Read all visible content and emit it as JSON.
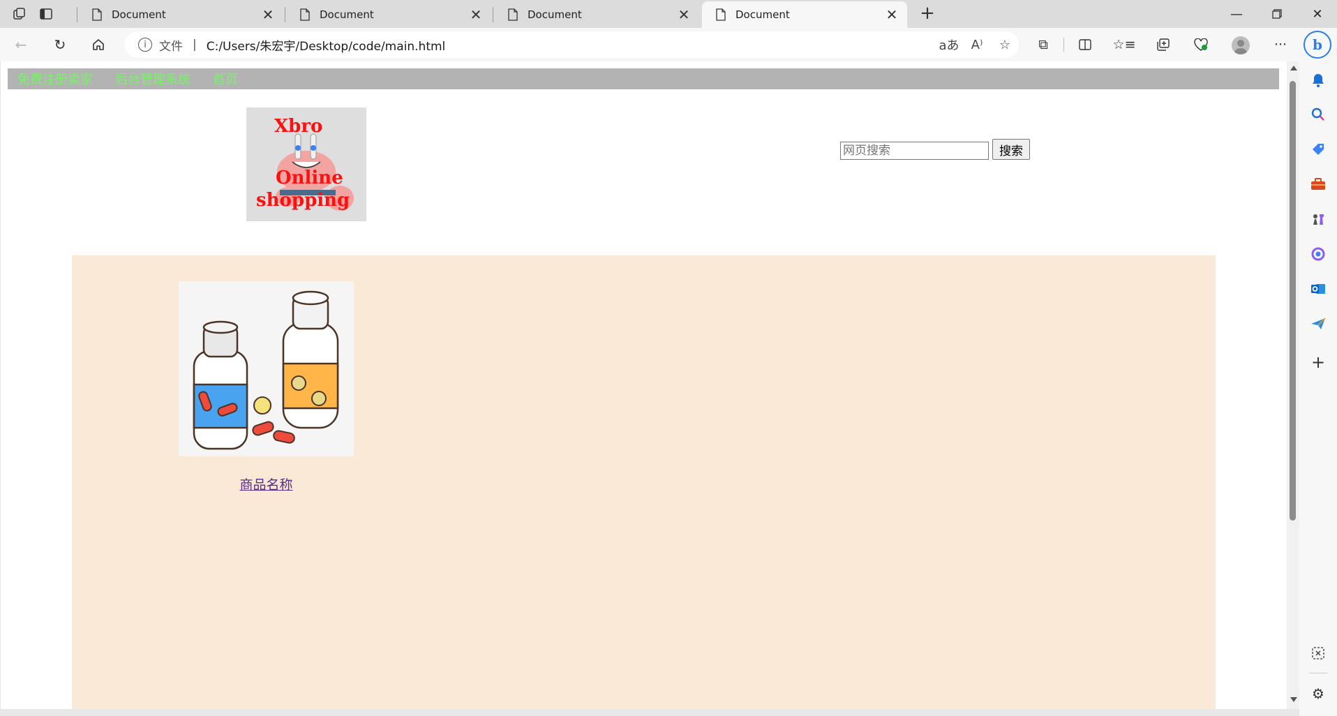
{
  "browser": {
    "tabs": [
      {
        "title": "Document",
        "active": false
      },
      {
        "title": "Document",
        "active": false
      },
      {
        "title": "Document",
        "active": false
      },
      {
        "title": "Document",
        "active": true
      }
    ],
    "address": {
      "label": "文件",
      "url": "C:/Users/朱宏宇/Desktop/code/main.html"
    }
  },
  "page": {
    "nav": {
      "links": [
        "免费注册卖家",
        "后台管理系统",
        "首页"
      ],
      "link_color": "#7cf06c",
      "bar_color": "#b3b3b3"
    },
    "logo": {
      "line1": "Xbro",
      "line2": "Online",
      "line3": "shopping"
    },
    "search": {
      "placeholder": "网页搜索",
      "button_label": "搜索"
    },
    "products": {
      "background": "#f9e9d6",
      "items": [
        {
          "name": "商品名称",
          "image": "medicine-bottles-illustration"
        }
      ]
    }
  }
}
